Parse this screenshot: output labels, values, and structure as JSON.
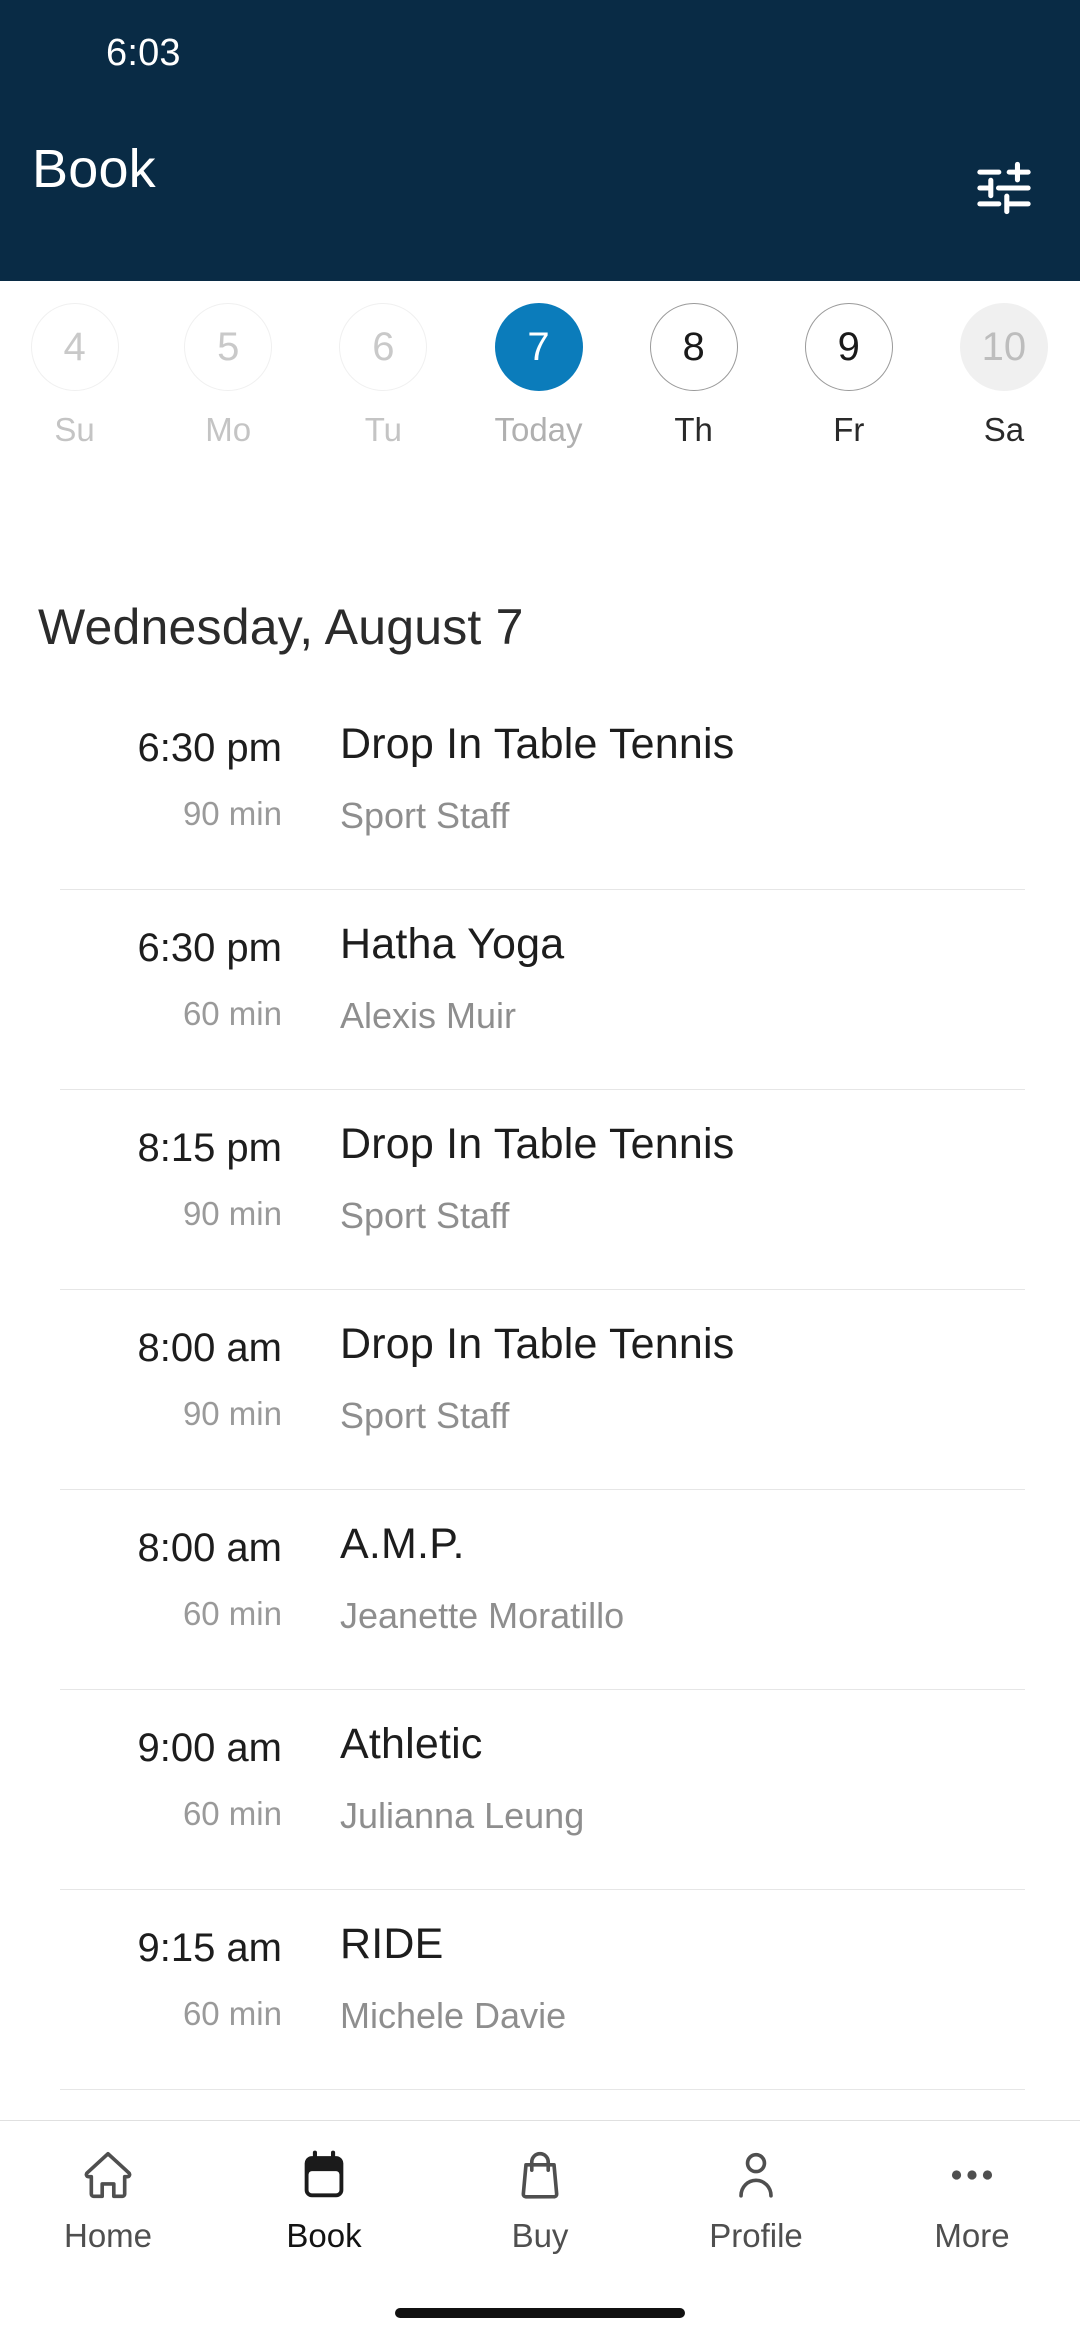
{
  "status": {
    "time": "6:03"
  },
  "header": {
    "title": "Book",
    "filter_icon": "sliders-filter-icon",
    "background_color": "#092b45"
  },
  "date_strip": {
    "accent_color": "#0b7cbb",
    "days": [
      {
        "num": "4",
        "label": "Su",
        "state": "past"
      },
      {
        "num": "5",
        "label": "Mo",
        "state": "past"
      },
      {
        "num": "6",
        "label": "Tu",
        "state": "past"
      },
      {
        "num": "7",
        "label": "Today",
        "state": "selected"
      },
      {
        "num": "8",
        "label": "Th",
        "state": "future"
      },
      {
        "num": "9",
        "label": "Fr",
        "state": "future"
      },
      {
        "num": "10",
        "label": "Sa",
        "state": "weekend"
      }
    ]
  },
  "day_title": "Wednesday, August 7",
  "classes": [
    {
      "time": "6:30 pm",
      "duration": "90 min",
      "name": "Drop In Table Tennis",
      "staff": "Sport Staff"
    },
    {
      "time": "6:30 pm",
      "duration": "60 min",
      "name": "Hatha Yoga",
      "staff": "Alexis Muir"
    },
    {
      "time": "8:15 pm",
      "duration": "90 min",
      "name": "Drop In Table Tennis",
      "staff": "Sport Staff"
    },
    {
      "time": "8:00 am",
      "duration": "90 min",
      "name": "Drop In Table Tennis",
      "staff": "Sport Staff"
    },
    {
      "time": "8:00 am",
      "duration": "60 min",
      "name": "A.M.P.",
      "staff": "Jeanette Moratillo"
    },
    {
      "time": "9:00 am",
      "duration": "60 min",
      "name": "Athletic",
      "staff": "Julianna Leung"
    },
    {
      "time": "9:15 am",
      "duration": "60 min",
      "name": "RIDE",
      "staff": "Michele Davie"
    }
  ],
  "bottom_nav": {
    "items": [
      {
        "label": "Home",
        "icon": "house-icon",
        "active": false
      },
      {
        "label": "Book",
        "icon": "calendar-icon",
        "active": true
      },
      {
        "label": "Buy",
        "icon": "shopping-bag-icon",
        "active": false
      },
      {
        "label": "Profile",
        "icon": "person-icon",
        "active": false
      },
      {
        "label": "More",
        "icon": "ellipsis-icon",
        "active": false
      }
    ]
  }
}
